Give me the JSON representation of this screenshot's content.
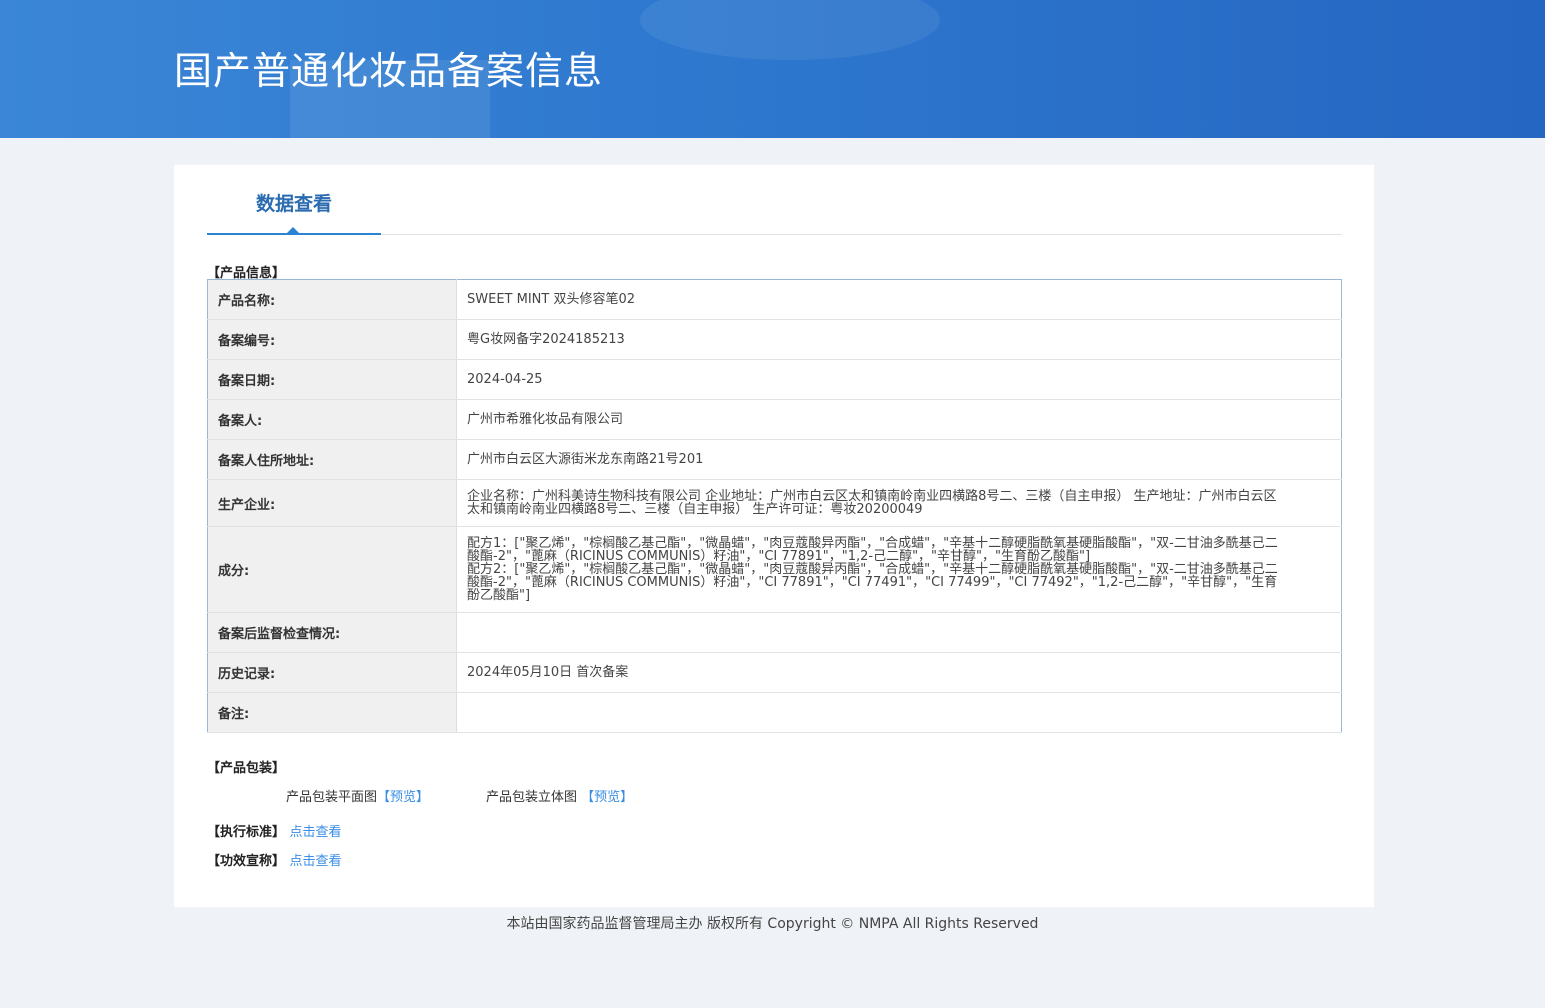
{
  "header": {
    "title": "国产普通化妆品备案信息"
  },
  "tab": {
    "label": "数据查看"
  },
  "product_info": {
    "heading": "【产品信息】",
    "rows": [
      {
        "label": "产品名称:",
        "value": "SWEET MINT 双头修容笔02"
      },
      {
        "label": "备案编号:",
        "value": "粤G妆网备字2024185213"
      },
      {
        "label": "备案日期:",
        "value": "2024-04-25"
      },
      {
        "label": "备案人:",
        "value": "广州市希雅化妆品有限公司"
      },
      {
        "label": "备案人住所地址:",
        "value": "广州市白云区大源街米龙东南路21号201"
      },
      {
        "label": "生产企业:",
        "value": "企业名称：广州科美诗生物科技有限公司 企业地址：广州市白云区太和镇南岭南业四横路8号二、三楼（自主申报） 生产地址：广州市白云区太和镇南岭南业四横路8号二、三楼（自主申报） 生产许可证：粤妆20200049"
      },
      {
        "label": "成分:",
        "value": "配方1：[\"聚乙烯\"，\"棕榈酸乙基己酯\"，\"微晶蜡\"，\"肉豆蔻酸异丙酯\"，\"合成蜡\"，\"辛基十二醇硬脂酰氧基硬脂酸酯\"，\"双-二甘油多酰基己二酸酯-2\"，\"蓖麻（RICINUS COMMUNIS）籽油\"，\"CI 77891\"，\"1,2-己二醇\"，\"辛甘醇\"，\"生育酚乙酸酯\"]",
        "value2": "配方2：[\"聚乙烯\"，\"棕榈酸乙基己酯\"，\"微晶蜡\"，\"肉豆蔻酸异丙酯\"，\"合成蜡\"，\"辛基十二醇硬脂酰氧基硬脂酸酯\"，\"双-二甘油多酰基己二酸酯-2\"，\"蓖麻（RICINUS COMMUNIS）籽油\"，\"CI 77891\"，\"CI 77491\"，\"CI 77499\"，\"CI 77492\"，\"1,2-己二醇\"，\"辛甘醇\"，\"生育酚乙酸酯\"]"
      },
      {
        "label": "备案后监督检查情况:",
        "value": ""
      },
      {
        "label": "历史记录:",
        "value": "2024年05月10日 首次备案"
      },
      {
        "label": "备注:",
        "value": ""
      }
    ]
  },
  "packaging": {
    "heading": "【产品包装】",
    "flat_label": "产品包装平面图",
    "flat_link": "【预览】",
    "solid_label": "产品包装立体图",
    "solid_link": "【预览】"
  },
  "standard": {
    "heading": "【执行标准】",
    "link": "点击查看"
  },
  "efficacy": {
    "heading": "【功效宣称】",
    "link": "点击查看"
  },
  "footer": {
    "text": "本站由国家药品监督管理局主办 版权所有 Copyright © NMPA All Rights Reserved"
  }
}
